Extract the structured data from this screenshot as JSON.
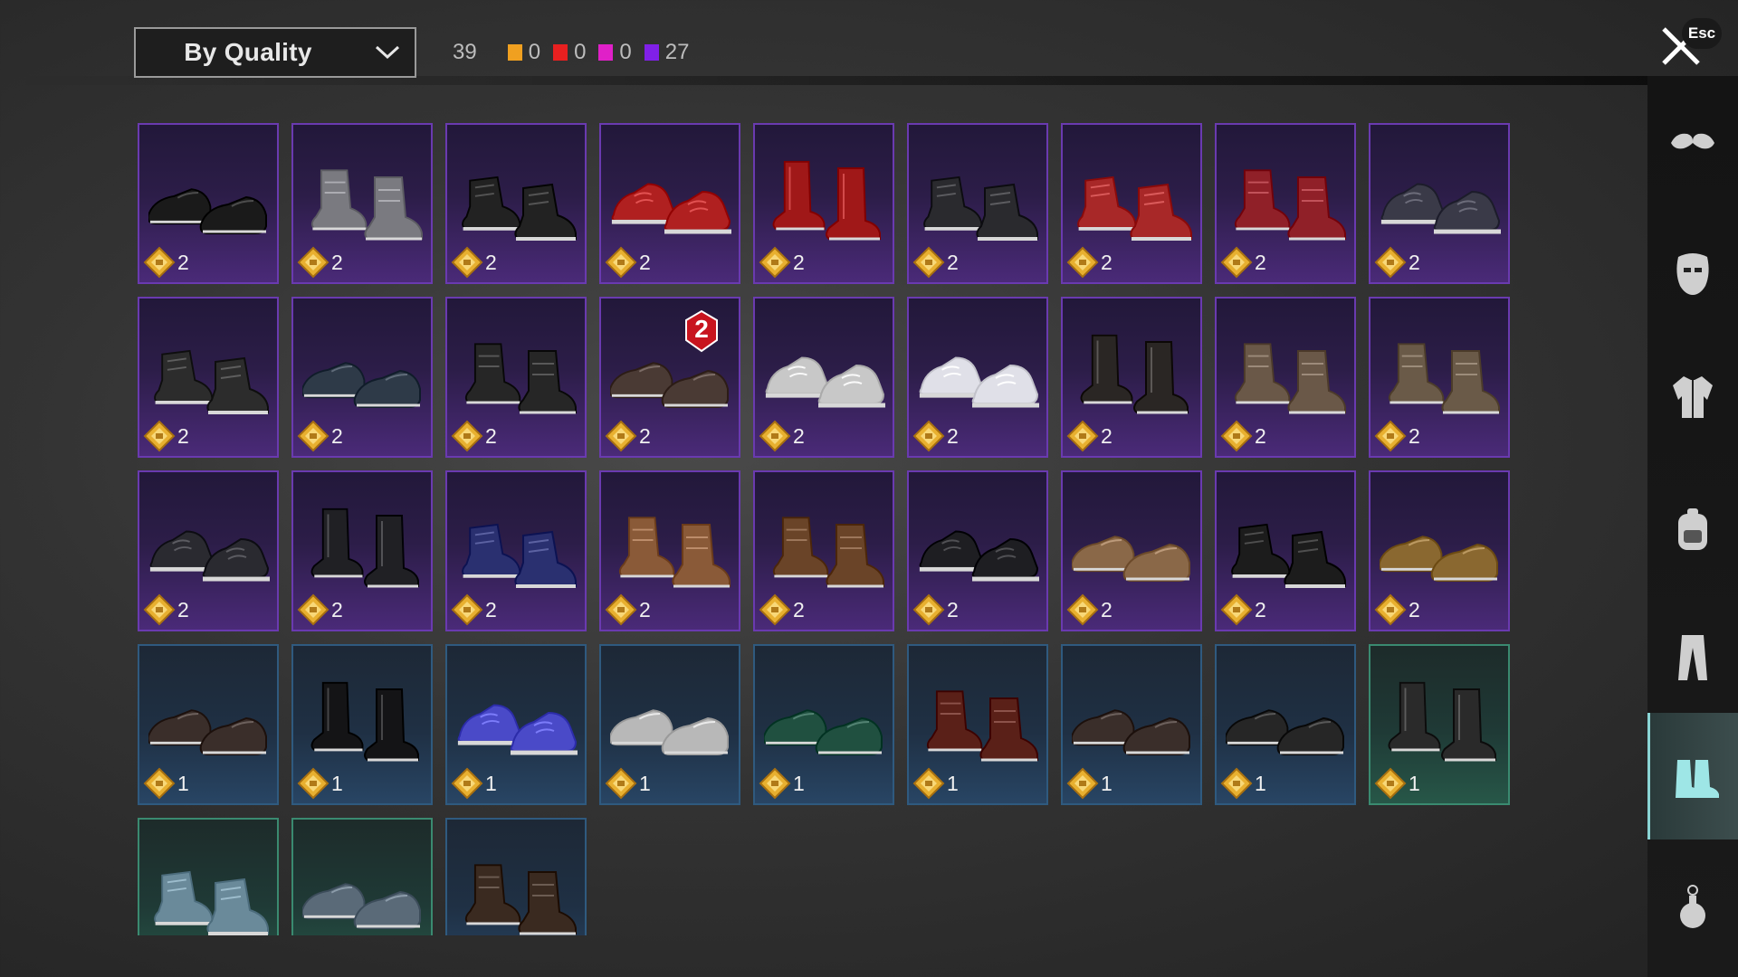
{
  "toolbar": {
    "sort_label": "By Quality",
    "total_count": "39",
    "quality_counts": [
      {
        "color": "#f0a020",
        "count": "0"
      },
      {
        "color": "#e82020",
        "count": "0"
      },
      {
        "color": "#e020c8",
        "count": "0"
      },
      {
        "color": "#8020e8",
        "count": "27"
      }
    ]
  },
  "close": {
    "esc_label": "Esc"
  },
  "items": [
    {
      "tier": "purple",
      "level": "2",
      "color": "#1a1a1a",
      "style": "low"
    },
    {
      "tier": "purple",
      "level": "2",
      "color": "#7a7a80",
      "style": "boot"
    },
    {
      "tier": "purple",
      "level": "2",
      "color": "#222222",
      "style": "high"
    },
    {
      "tier": "purple",
      "level": "2",
      "color": "#b02020",
      "style": "sneaker"
    },
    {
      "tier": "purple",
      "level": "2",
      "color": "#a01818",
      "style": "tall"
    },
    {
      "tier": "purple",
      "level": "2",
      "color": "#2a2a2e",
      "style": "high"
    },
    {
      "tier": "purple",
      "level": "2",
      "color": "#a82828",
      "style": "high"
    },
    {
      "tier": "purple",
      "level": "2",
      "color": "#902028",
      "style": "boot"
    },
    {
      "tier": "purple",
      "level": "2",
      "color": "#3a3a48",
      "style": "sneaker"
    },
    {
      "tier": "purple",
      "level": "2",
      "color": "#2c2c2c",
      "style": "high"
    },
    {
      "tier": "purple",
      "level": "2",
      "color": "#2e3a48",
      "style": "low"
    },
    {
      "tier": "purple",
      "level": "2",
      "color": "#262626",
      "style": "boot"
    },
    {
      "tier": "purple",
      "level": "2",
      "color": "#4a3a34",
      "style": "low",
      "badge": "2"
    },
    {
      "tier": "purple",
      "level": "2",
      "color": "#c8c8c8",
      "style": "sneaker"
    },
    {
      "tier": "purple",
      "level": "2",
      "color": "#e0e0e8",
      "style": "sneaker"
    },
    {
      "tier": "purple",
      "level": "2",
      "color": "#2a2624",
      "style": "tall"
    },
    {
      "tier": "purple",
      "level": "2",
      "color": "#6a5848",
      "style": "boot"
    },
    {
      "tier": "purple",
      "level": "2",
      "color": "#6a5a48",
      "style": "boot"
    },
    {
      "tier": "purple",
      "level": "2",
      "color": "#2a2a30",
      "style": "sneaker"
    },
    {
      "tier": "purple",
      "level": "2",
      "color": "#202024",
      "style": "tall"
    },
    {
      "tier": "purple",
      "level": "2",
      "color": "#2a3070",
      "style": "high"
    },
    {
      "tier": "purple",
      "level": "2",
      "color": "#8a5a38",
      "style": "boot"
    },
    {
      "tier": "purple",
      "level": "2",
      "color": "#6a4428",
      "style": "boot"
    },
    {
      "tier": "purple",
      "level": "2",
      "color": "#1e1e22",
      "style": "sneaker"
    },
    {
      "tier": "purple",
      "level": "2",
      "color": "#8a6848",
      "style": "low"
    },
    {
      "tier": "purple",
      "level": "2",
      "color": "#1c1c1c",
      "style": "high"
    },
    {
      "tier": "purple",
      "level": "2",
      "color": "#8a6830",
      "style": "low"
    },
    {
      "tier": "blue",
      "level": "1",
      "color": "#3a2e2a",
      "style": "low"
    },
    {
      "tier": "blue",
      "level": "1",
      "color": "#141416",
      "style": "tall"
    },
    {
      "tier": "blue",
      "level": "1",
      "color": "#4a4ac8",
      "style": "sneaker"
    },
    {
      "tier": "blue",
      "level": "1",
      "color": "#b8b8b8",
      "style": "low"
    },
    {
      "tier": "blue",
      "level": "1",
      "color": "#205040",
      "style": "low"
    },
    {
      "tier": "blue",
      "level": "1",
      "color": "#5a2018",
      "style": "boot"
    },
    {
      "tier": "blue",
      "level": "1",
      "color": "#3a2e2a",
      "style": "low"
    },
    {
      "tier": "blue",
      "level": "1",
      "color": "#262626",
      "style": "low"
    },
    {
      "tier": "green",
      "level": "1",
      "color": "#2a2a2a",
      "style": "tall"
    },
    {
      "tier": "green",
      "level": "",
      "color": "#6a8a9a",
      "style": "high"
    },
    {
      "tier": "green",
      "level": "",
      "color": "#5a6a78",
      "style": "low"
    },
    {
      "tier": "blue",
      "level": "",
      "color": "#3a2a20",
      "style": "boot"
    }
  ],
  "sidebar": [
    {
      "name": "goggles-icon",
      "active": false
    },
    {
      "name": "mask-icon",
      "active": false
    },
    {
      "name": "jacket-icon",
      "active": false
    },
    {
      "name": "backpack-icon",
      "active": false
    },
    {
      "name": "pants-icon",
      "active": false
    },
    {
      "name": "shoes-icon",
      "active": true
    },
    {
      "name": "grenade-icon",
      "active": false
    }
  ]
}
